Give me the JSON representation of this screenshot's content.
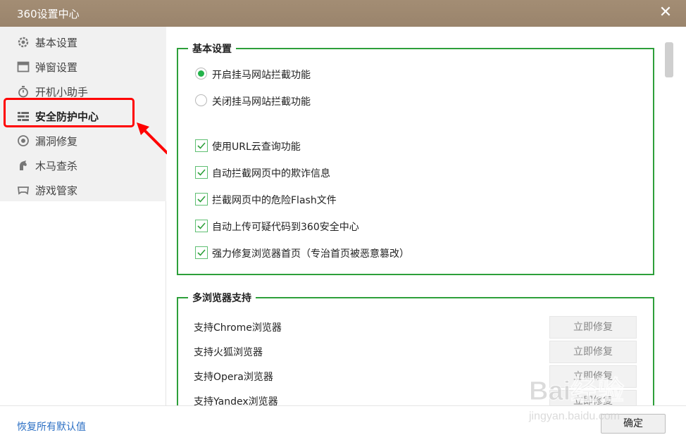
{
  "window": {
    "title": "360设置中心",
    "close_icon": "close-icon",
    "close_glyph": "✕"
  },
  "sidebar": {
    "items": [
      {
        "label": "基本设置",
        "icon": "gear-icon"
      },
      {
        "label": "弹窗设置",
        "icon": "window-icon"
      },
      {
        "label": "开机小助手",
        "icon": "stopwatch-icon"
      },
      {
        "label": "安全防护中心",
        "icon": "firewall-icon",
        "active": true
      },
      {
        "label": "漏洞修复",
        "icon": "patch-icon"
      },
      {
        "label": "木马查杀",
        "icon": "horse-icon"
      },
      {
        "label": "游戏管家",
        "icon": "gamepad-icon"
      }
    ]
  },
  "basic_group": {
    "legend": "基本设置",
    "radios": [
      {
        "label": "开启挂马网站拦截功能",
        "checked": true
      },
      {
        "label": "关闭挂马网站拦截功能",
        "checked": false
      }
    ],
    "checkboxes": [
      {
        "label": "使用URL云查询功能",
        "checked": true
      },
      {
        "label": "自动拦截网页中的欺诈信息",
        "checked": true
      },
      {
        "label": "拦截网页中的危险Flash文件",
        "checked": true
      },
      {
        "label": "自动上传可疑代码到360安全中心",
        "checked": true
      },
      {
        "label": "强力修复浏览器首页（专治首页被恶意篡改）",
        "checked": true
      }
    ]
  },
  "browser_group": {
    "legend": "多浏览器支持",
    "rows": [
      {
        "label": "支持Chrome浏览器",
        "button": "立即修复"
      },
      {
        "label": "支持火狐浏览器",
        "button": "立即修复"
      },
      {
        "label": "支持Opera浏览器",
        "button": "立即修复"
      },
      {
        "label": "支持Yandex浏览器",
        "button": "立即修复"
      }
    ]
  },
  "footer": {
    "restore_label": "恢复所有默认值",
    "ok_label": "确定"
  },
  "watermark": {
    "brand": "Bai经验",
    "url": "jingyan.baidu.com"
  },
  "colors": {
    "titlebar": "#9f8970",
    "accent_green": "#2d9f3a",
    "highlight_red": "#ff0000",
    "link_blue": "#2b6fc4"
  }
}
